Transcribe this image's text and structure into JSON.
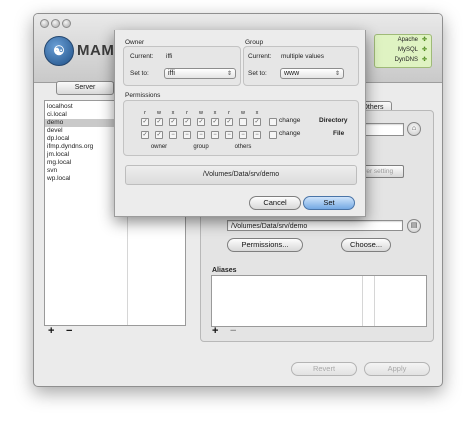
{
  "app": {
    "title": "MAMP",
    "logo_glyph": "☯"
  },
  "status": {
    "items": [
      {
        "label": "Apache"
      },
      {
        "label": "MySQL"
      },
      {
        "label": "DynDNS"
      }
    ],
    "running_color": "#4e8a1d"
  },
  "tabs": {
    "server": "Server",
    "others": "Others"
  },
  "hosts": {
    "items": [
      "localhost",
      "ci.local",
      "demo",
      "devel",
      "dp.local",
      "ifmp.dyndns.org",
      "jm.local",
      "mg.local",
      "svn",
      "wp.local"
    ],
    "selected": "demo",
    "add": "+",
    "remove": "−"
  },
  "sheet": {
    "owner": {
      "title": "Owner",
      "current_label": "Current:",
      "current_value": "iffi",
      "set_label": "Set to:",
      "set_value": "iffi"
    },
    "group": {
      "title": "Group",
      "current_label": "Current:",
      "current_value": "multiple values",
      "set_label": "Set to:",
      "set_value": "www"
    },
    "permissions": {
      "title": "Permissions",
      "rwx": [
        "r",
        "w",
        "x"
      ],
      "classes": [
        "owner",
        "group",
        "others"
      ],
      "change_label": "change",
      "directory_label": "Directory",
      "file_label": "File"
    },
    "path": "/Volumes/Data/srv/demo",
    "cancel": "Cancel",
    "set": "Set"
  },
  "right": {
    "server_setting_btn": "rver setting",
    "docroot_path": "/Volumes/Data/srv/demo",
    "permissions_btn": "Permissions...",
    "choose_btn": "Choose...",
    "aliases_label": "Aliases",
    "alias_add": "+",
    "alias_remove": "−"
  },
  "footer": {
    "revert": "Revert",
    "apply": "Apply"
  }
}
